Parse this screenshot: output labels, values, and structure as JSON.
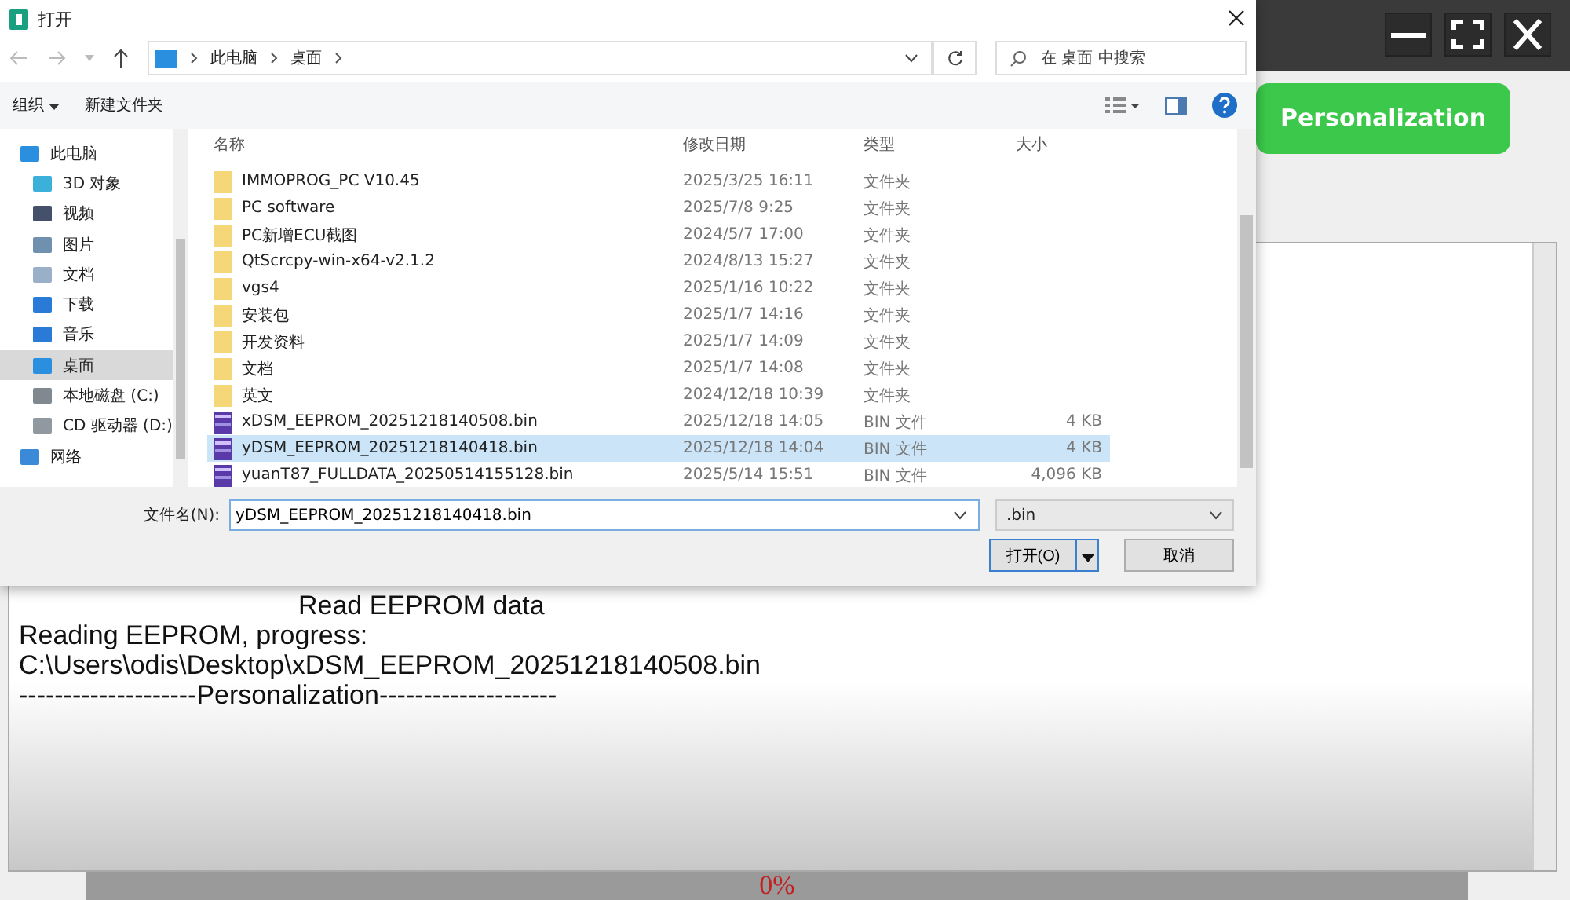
{
  "app": {
    "action_button": "Personalization",
    "log": [
      {
        "kind": "heading",
        "text": "Read EEPROM data"
      },
      {
        "kind": "text",
        "text": "Reading EEPROM, progress:"
      },
      {
        "kind": "text",
        "text": "C:\\Users\\odis\\Desktop\\xDSM_EEPROM_20251218140508.bin"
      },
      {
        "kind": "text",
        "text": "--------------------Personalization--------------------"
      }
    ],
    "progress": {
      "level": 0,
      "text": "0%"
    }
  },
  "dialog": {
    "title": "打开",
    "breadcrumb": [
      "此电脑",
      "桌面"
    ],
    "search": {
      "placeholder": "在 桌面 中搜索"
    },
    "toolbar": {
      "organize": "组织",
      "new_folder": "新建文件夹"
    },
    "sidebar": [
      {
        "label": "此电脑",
        "selected": false,
        "children": [
          {
            "label": "3D 对象",
            "selected": false
          },
          {
            "label": "视频",
            "selected": false
          },
          {
            "label": "图片",
            "selected": false
          },
          {
            "label": "文档",
            "selected": false
          },
          {
            "label": "下载",
            "selected": false
          },
          {
            "label": "音乐",
            "selected": false
          },
          {
            "label": "桌面",
            "selected": true
          },
          {
            "label": "本地磁盘 (C:)",
            "selected": false
          },
          {
            "label": "CD 驱动器 (D:)",
            "selected": false
          }
        ]
      },
      {
        "label": "网络",
        "selected": false
      }
    ],
    "columns": [
      "名称",
      "修改日期",
      "类型",
      "大小"
    ],
    "files": [
      {
        "kind": "folder",
        "name": "IMMOPROG_PC  V10.45",
        "date": "2025/3/25 16:11",
        "type": "文件夹",
        "selected": false
      },
      {
        "kind": "folder",
        "name": "PC software",
        "date": "2025/7/8 9:25",
        "type": "文件夹",
        "selected": false
      },
      {
        "kind": "folder",
        "name": "PC新增ECU截图",
        "date": "2024/5/7 17:00",
        "type": "文件夹",
        "selected": false
      },
      {
        "kind": "folder",
        "name": "QtScrcpy-win-x64-v2.1.2",
        "date": "2024/8/13 15:27",
        "type": "文件夹",
        "selected": false
      },
      {
        "kind": "folder",
        "name": "vgs4",
        "date": "2025/1/16 10:22",
        "type": "文件夹",
        "selected": false
      },
      {
        "kind": "folder",
        "name": "安装包",
        "date": "2025/1/7 14:16",
        "type": "文件夹",
        "selected": false
      },
      {
        "kind": "folder",
        "name": "开发资料",
        "date": "2025/1/7 14:09",
        "type": "文件夹",
        "selected": false
      },
      {
        "kind": "folder",
        "name": "文档",
        "date": "2025/1/7 14:08",
        "type": "文件夹",
        "selected": false
      },
      {
        "kind": "folder",
        "name": "英文",
        "date": "2024/12/18 10:39",
        "type": "文件夹",
        "selected": false
      },
      {
        "kind": "bin",
        "name": "xDSM_EEPROM_20251218140508.bin",
        "date": "2025/12/18 14:05",
        "type": "BIN 文件",
        "size": "4 KB",
        "selected": false
      },
      {
        "kind": "bin",
        "name": "yDSM_EEPROM_20251218140418.bin",
        "date": "2025/12/18 14:04",
        "type": "BIN 文件",
        "size": "4 KB",
        "selected": true
      },
      {
        "kind": "bin",
        "name": "yuanT87_FULLDATA_20250514155128.bin",
        "date": "2025/5/14 15:51",
        "type": "BIN 文件",
        "size": "4,096 KB",
        "selected": false
      }
    ],
    "filename_label": "文件名(N):",
    "filename": "yDSM_EEPROM_20251218140418.bin",
    "filter": ".bin",
    "buttons": {
      "open": "打开(O)",
      "cancel": "取消"
    }
  }
}
